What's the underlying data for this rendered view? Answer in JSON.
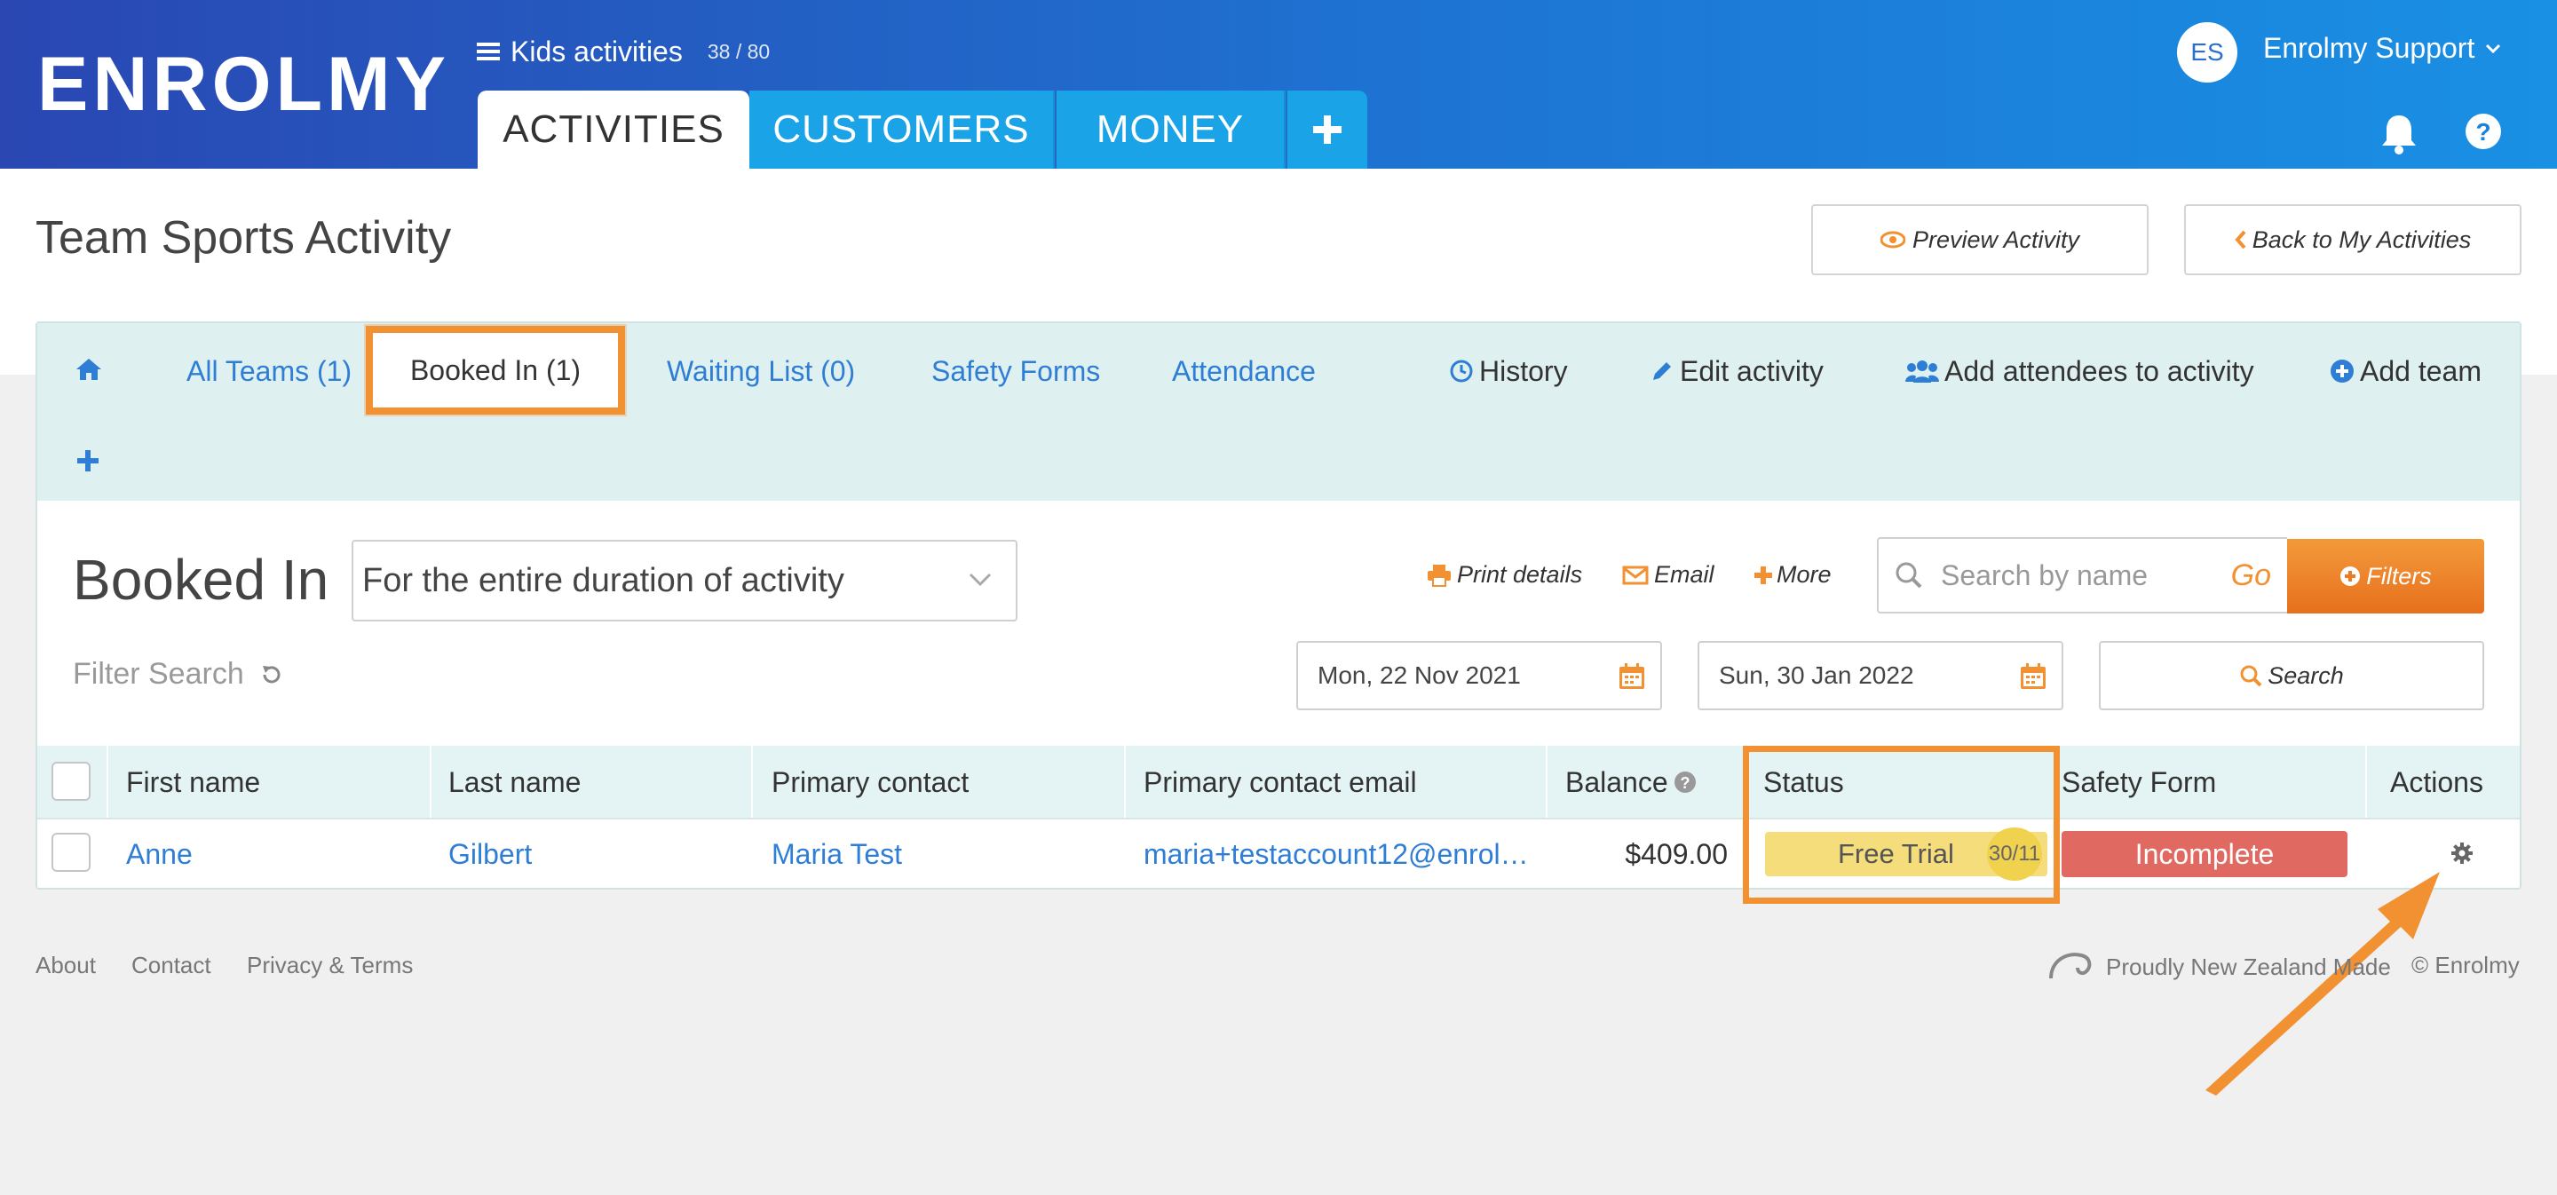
{
  "brand": {
    "logo": "ENROLMY",
    "accent": "#f29131",
    "primary_blue": "#2e7ed6"
  },
  "header": {
    "context_title": "Kids activities",
    "context_count": "38 / 80",
    "tabs": [
      {
        "label": "ACTIVITIES"
      },
      {
        "label": "CUSTOMERS"
      },
      {
        "label": "MONEY"
      }
    ],
    "add_tab_icon": "plus-icon",
    "user": {
      "initials": "ES",
      "name": "Enrolmy Support"
    },
    "icons": [
      "bell-icon",
      "help-icon"
    ]
  },
  "page": {
    "title": "Team Sports Activity",
    "preview_button": "Preview Activity",
    "back_button": "Back to My Activities"
  },
  "subnav": {
    "all_teams": "All Teams (1)",
    "booked_in": "Booked In (1)",
    "waiting_list": "Waiting List (0)",
    "safety_forms": "Safety Forms",
    "attendance": "Attendance",
    "history": "History",
    "edit_activity": "Edit activity",
    "add_attendees": "Add attendees to activity",
    "add_team": "Add team"
  },
  "section": {
    "title": "Booked In",
    "duration_selected": "For the entire duration of activity",
    "print_details": "Print details",
    "email": "Email",
    "more": "More",
    "search_placeholder": "Search by name",
    "go": "Go",
    "filters": "Filters",
    "filter_search": "Filter Search",
    "date_from": "Mon, 22 Nov 2021",
    "date_to": "Sun, 30 Jan 2022",
    "search_button": "Search"
  },
  "table": {
    "columns": {
      "first_name": "First name",
      "last_name": "Last name",
      "primary_contact": "Primary contact",
      "primary_contact_email": "Primary contact email",
      "balance": "Balance",
      "status": "Status",
      "safety_form": "Safety Form",
      "actions": "Actions"
    },
    "rows": [
      {
        "first_name": "Anne",
        "last_name": "Gilbert",
        "primary_contact": "Maria Test",
        "primary_contact_email": "maria+testaccount12@enrol…",
        "balance": "$409.00",
        "status": "Free Trial",
        "status_count": "30/11",
        "safety_form": "Incomplete"
      }
    ]
  },
  "footer": {
    "about": "About",
    "contact": "Contact",
    "privacy": "Privacy & Terms",
    "made_in": "Proudly New Zealand Made",
    "copyright": "© Enrolmy"
  }
}
